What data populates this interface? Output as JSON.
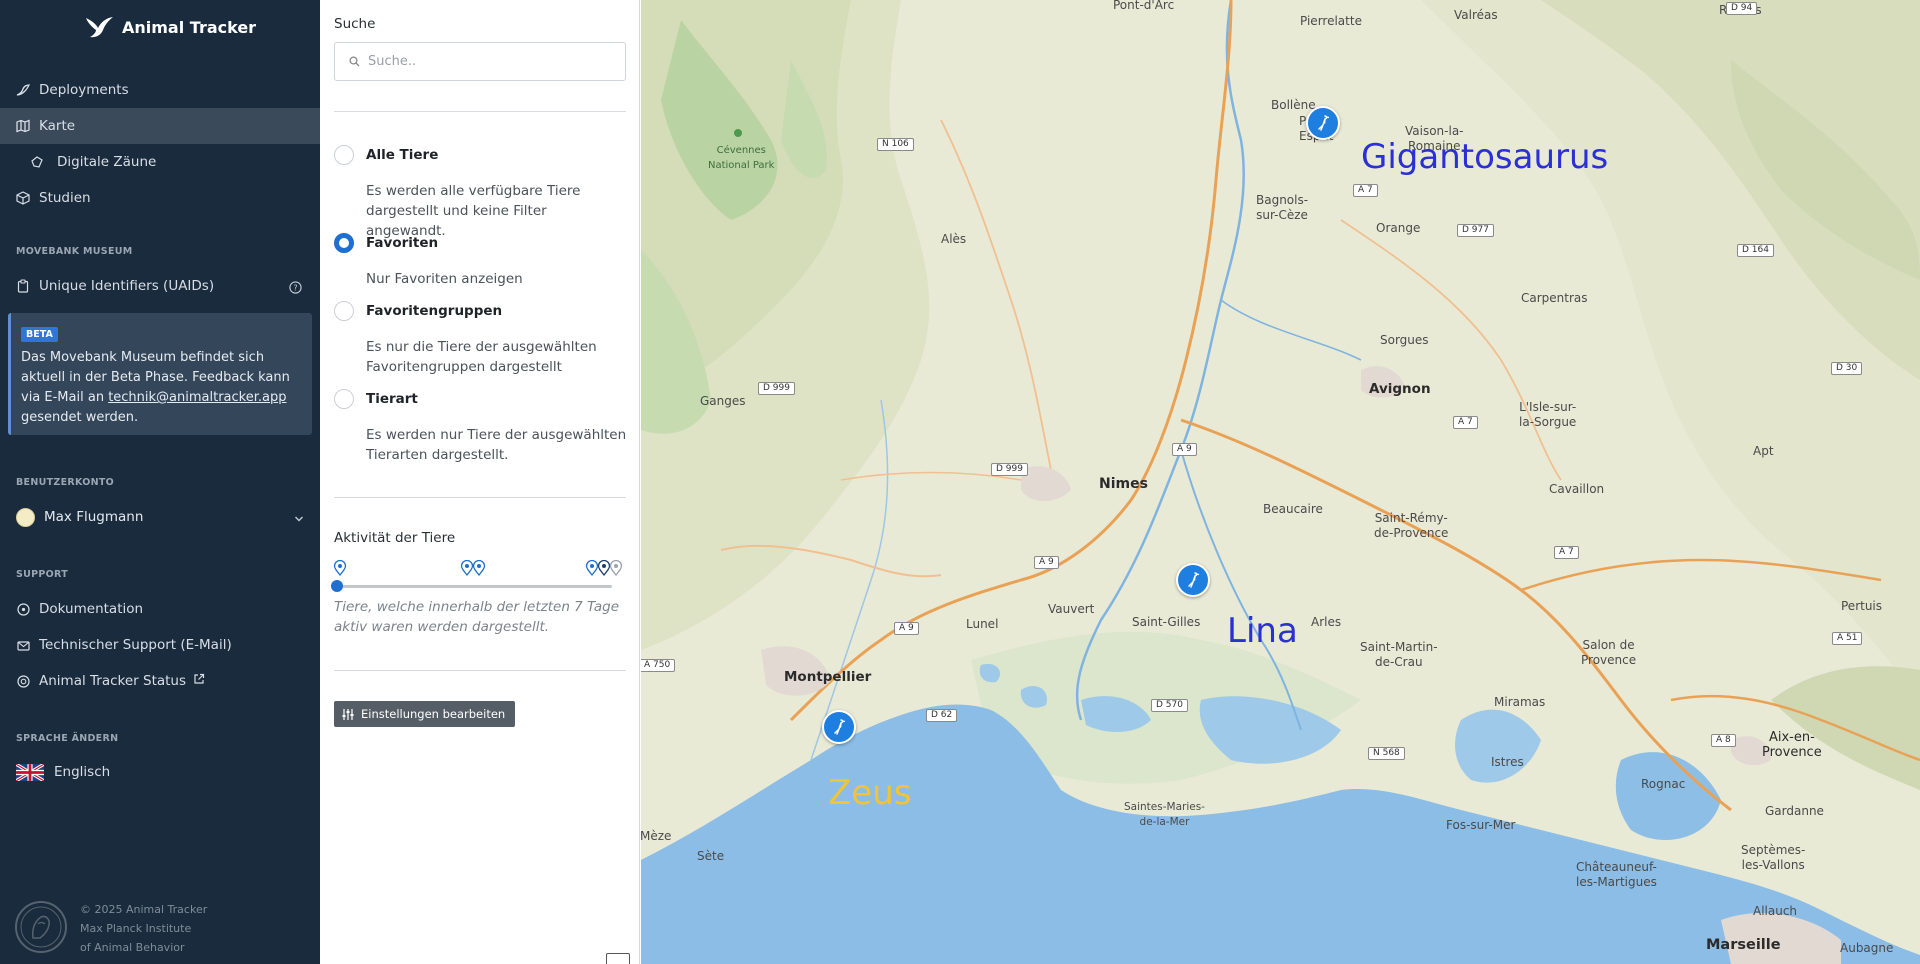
{
  "app": {
    "name": "Animal Tracker"
  },
  "nav": {
    "items": [
      {
        "label": "Deployments",
        "icon": "bird-icon"
      },
      {
        "label": "Karte",
        "icon": "map-icon",
        "active": true
      },
      {
        "label": "Digitale Zäune",
        "icon": "fence-icon"
      },
      {
        "label": "Studien",
        "icon": "box-icon"
      }
    ]
  },
  "museum": {
    "section_title": "MOVEBANK MUSEUM",
    "uaid_label": "Unique Identifiers (UAIDs)",
    "beta_badge": "BETA",
    "beta_text_before": "Das Movebank Museum befindet sich aktuell in der Beta Phase. Feedback kann via E-Mail an ",
    "beta_email": "technik@animaltracker.app",
    "beta_text_after": " gesendet werden."
  },
  "account": {
    "section_title": "BENUTZERKONTO",
    "user_name": "Max Flugmann"
  },
  "support": {
    "section_title": "SUPPORT",
    "items": [
      {
        "label": "Dokumentation"
      },
      {
        "label": "Technischer Support (E-Mail)"
      },
      {
        "label": "Animal Tracker Status"
      }
    ]
  },
  "language": {
    "section_title": "SPRACHE ÄNDERN",
    "current": "Englisch"
  },
  "footer": {
    "line1": "© 2025 Animal Tracker",
    "line2": "Max Planck Institute",
    "line3": "of Animal Behavior"
  },
  "filter": {
    "search_label": "Suche",
    "search_placeholder": "Suche..",
    "options": [
      {
        "label": "Alle Tiere",
        "desc": "Es werden alle verfügbare Tiere dargestellt und keine Filter angewandt.",
        "checked": false
      },
      {
        "label": "Favoriten",
        "desc": "Nur Favoriten anzeigen",
        "checked": true
      },
      {
        "label": "Favoritengruppen",
        "desc": "Es nur die Tiere der ausgewählten Favoritengruppen dargestellt",
        "checked": false
      },
      {
        "label": "Tierart",
        "desc": "Es werden nur Tiere der ausgewählten Tierarten dargestellt.",
        "checked": false
      }
    ],
    "activity_title": "Aktivität der Tiere",
    "activity_slider_level": 0,
    "activity_desc": "Tiere, welche innerhalb der letzten 7 Tage aktiv waren werden dargestellt.",
    "edit_button": "Einstellungen bearbeiten"
  },
  "map": {
    "animals": [
      {
        "name": "Gigantosaurus",
        "color": "#2a2fd6"
      },
      {
        "name": "Lina",
        "color": "#2a2fd6"
      },
      {
        "name": "Zeus",
        "color": "#f4c430"
      }
    ],
    "places": {
      "pont_darc": "Pont-d'Arc",
      "pierrelatte": "Pierrelatte",
      "valreas": "Valréas",
      "rosans": "Rosans",
      "bollene": "Bollène",
      "pont_st_esprit_1": "Pont-S",
      "pont_st_esprit_2": "Esprit",
      "vaison_1": "Vaison-la-",
      "vaison_2": "Romaine",
      "cevennes_1": "Cévennes",
      "cevennes_2": "National Park",
      "bagnols_1": "Bagnols-",
      "bagnols_2": "sur-Cèze",
      "orange": "Orange",
      "ales": "Alès",
      "carpentras": "Carpentras",
      "sorgues": "Sorgues",
      "ganges": "Ganges",
      "avignon": "Avignon",
      "lisle_1": "L'Isle-sur-",
      "lisle_2": "la-Sorgue",
      "apt": "Apt",
      "nimes": "Nimes",
      "beaucaire": "Beaucaire",
      "saint_remy_1": "Saint-Rémy-",
      "saint_remy_2": "de-Provence",
      "cavaillon": "Cavaillon",
      "vauvert": "Vauvert",
      "lunel": "Lunel",
      "saint_gilles": "Saint-Gilles",
      "arles": "Arles",
      "pertuis": "Pertuis",
      "saint_martin_1": "Saint-Martin-",
      "saint_martin_2": "de-Crau",
      "salon_1": "Salon de",
      "salon_2": "Provence",
      "montpellier": "Montpellier",
      "miramas": "Miramas",
      "aix_1": "Aix-en-",
      "aix_2": "Provence",
      "istres": "Istres",
      "rognac": "Rognac",
      "saintes_1": "Saintes-Maries-",
      "saintes_2": "de-la-Mer",
      "gardanne": "Gardanne",
      "fos": "Fos-sur-Mer",
      "meze": "Mèze",
      "sete": "Sète",
      "chateauneuf_1": "Châteauneuf-",
      "chateauneuf_2": "les-Martigues",
      "septemes_1": "Septèmes-",
      "septemes_2": "les-Vallons",
      "allauch": "Allauch",
      "marseille": "Marseille",
      "aubagne": "Aubagne"
    },
    "roads": {
      "d94": "D 94",
      "n106": "N 106",
      "a7a": "A 7",
      "d977": "D 977",
      "d164": "D 164",
      "d999a": "D 999",
      "d30": "D 30",
      "a9a": "A 9",
      "d999b": "D 999",
      "a7b": "A 7",
      "a9b": "A 9",
      "a7c": "A 7",
      "a9c": "A 9",
      "a51": "A 51",
      "a750": "A 750",
      "d62": "D 62",
      "d570": "D 570",
      "n568": "N 568",
      "a8": "A 8"
    }
  }
}
